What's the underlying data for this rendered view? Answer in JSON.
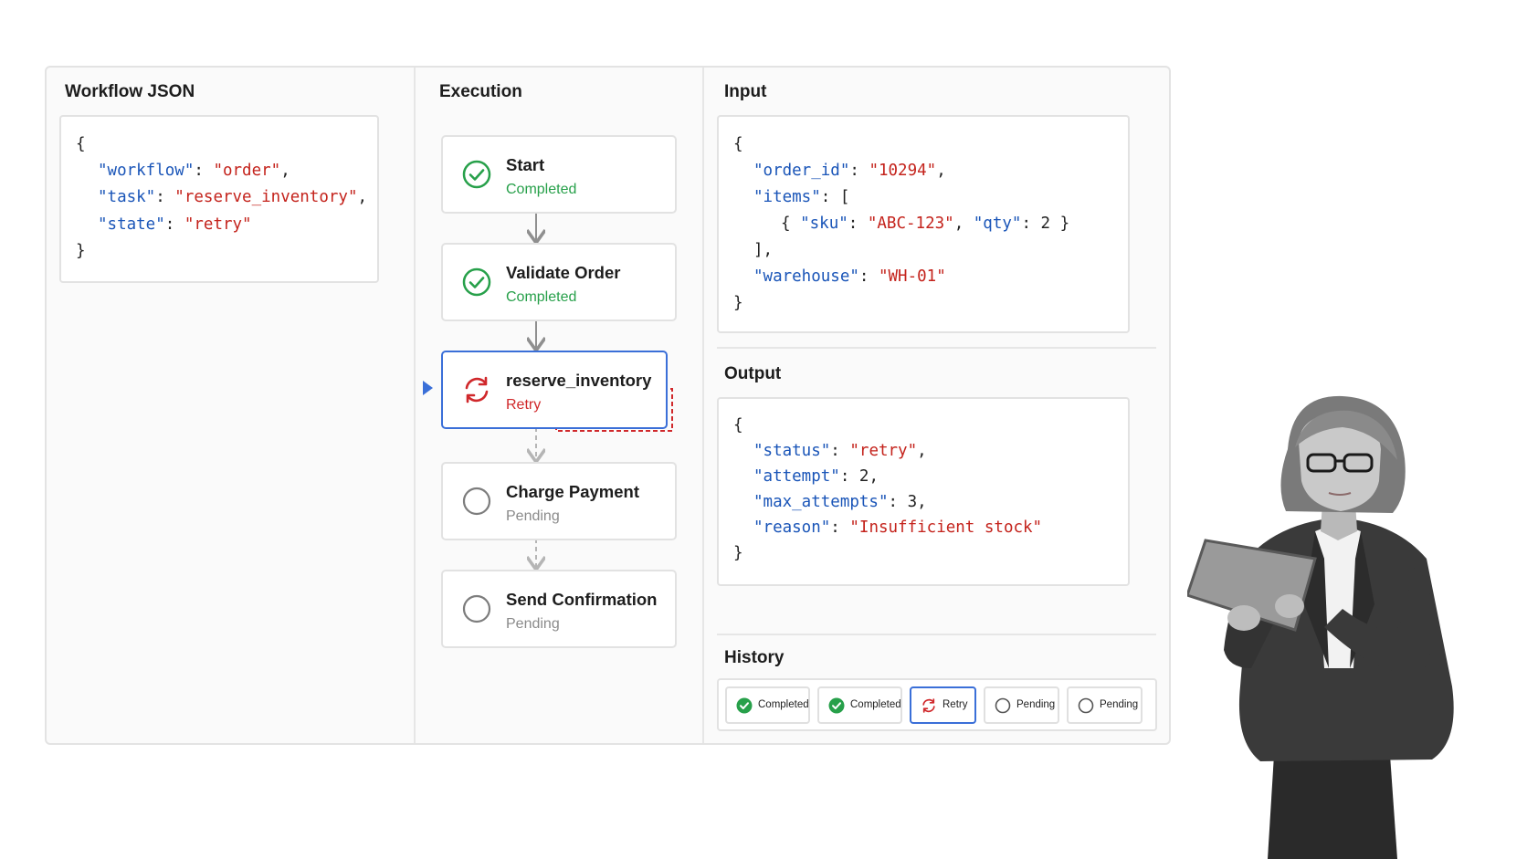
{
  "workflow_panel": {
    "title": "Workflow JSON",
    "json": {
      "open": "{",
      "lines": [
        {
          "key": "\"workflow\"",
          "value": "\"order\"",
          "suffix": ","
        },
        {
          "key": "\"task\"",
          "value": "\"reserve_inventory\"",
          "suffix": ","
        },
        {
          "key": "\"state\"",
          "value": "\"retry\"",
          "suffix": ""
        }
      ],
      "close": "}"
    }
  },
  "execution": {
    "title": "Execution",
    "steps": [
      {
        "name": "Start",
        "status": "Completed",
        "icon": "check-circle-icon"
      },
      {
        "name": "Validate Order",
        "status": "Completed",
        "icon": "check-circle-icon"
      },
      {
        "name": "reserve_inventory",
        "status": "Retry",
        "icon": "retry-icon"
      },
      {
        "name": "Charge Payment",
        "status": "Pending",
        "icon": "empty-circle-icon"
      },
      {
        "name": "Send Confirmation",
        "status": "Pending",
        "icon": "empty-circle-icon"
      }
    ]
  },
  "input_panel": {
    "title": "Input",
    "open": "{",
    "order_id_key": "\"order_id\"",
    "order_id_value": "\"10294\"",
    "items_key": "\"items\"",
    "items_open": "[",
    "item_open": "{",
    "sku_key": "\"sku\"",
    "sku_value": "\"ABC-123\"",
    "qty_key": "\"qty\"",
    "qty_value": "2",
    "item_close": "}",
    "items_close": "],",
    "warehouse_key": "\"warehouse\"",
    "warehouse_value": "\"WH-01\"",
    "close": "}"
  },
  "output_panel": {
    "title": "Output",
    "open": "{",
    "lines": [
      {
        "key": "\"status\"",
        "value": "\"retry\"",
        "suffix": ",",
        "type": "string"
      },
      {
        "key": "\"attempt\"",
        "value": "2",
        "suffix": ",",
        "type": "number"
      },
      {
        "key": "\"max_attempts\"",
        "value": "3",
        "suffix": ",",
        "type": "number"
      },
      {
        "key": "\"reason\"",
        "value": "\"Insufficient stock\"",
        "suffix": "",
        "type": "string"
      }
    ],
    "close": "}"
  },
  "history": {
    "title": "History",
    "chips": [
      {
        "label": "Completed",
        "icon": "check-filled-icon"
      },
      {
        "label": "Completed",
        "icon": "check-filled-icon"
      },
      {
        "label": "Retry",
        "icon": "retry-icon"
      },
      {
        "label": "Pending",
        "icon": "empty-circle-icon"
      },
      {
        "label": "Pending",
        "icon": "empty-circle-icon"
      }
    ]
  },
  "colors": {
    "key": "#1a55b8",
    "string": "#c4231c",
    "success": "#27a04a",
    "retry": "#d0282b",
    "pending": "#8a8a8a",
    "active_border": "#3a6fd8"
  }
}
